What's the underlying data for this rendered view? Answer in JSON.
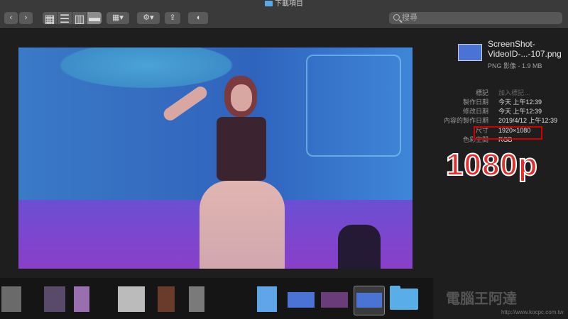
{
  "window": {
    "title": "下載項目"
  },
  "toolbar": {
    "back_label": "‹",
    "forward_label": "›",
    "views": [
      "▦",
      "☰",
      "▥",
      "▬"
    ],
    "group_label": "▦▾",
    "action_label": "⚙▾",
    "share_label": "⇪",
    "tag_label": "◖"
  },
  "search": {
    "placeholder": "搜尋"
  },
  "file": {
    "name": "ScreenShot-VideoID-...-107.png",
    "subtitle": "PNG 影像 - 1.9 MB"
  },
  "metadata": [
    {
      "key": "標記",
      "value": "加入標記…",
      "placeholder": true
    },
    {
      "key": "製作日期",
      "value": "今天 上午12:39"
    },
    {
      "key": "修改日期",
      "value": "今天 上午12:39"
    },
    {
      "key": "內容的製作日期",
      "value": "2019/4/12 上午12:39"
    },
    {
      "key": "尺寸",
      "value": "1920×1080"
    },
    {
      "key": "色彩空間",
      "value": "RGB"
    }
  ],
  "annotation": {
    "text": "1080p",
    "color": "#e42d2d"
  },
  "watermark": {
    "text": "電腦王阿達",
    "url": "http://www.kocpc.com.tw"
  },
  "colors": {
    "highlight": "#d40000",
    "folder": "#5aaee8"
  }
}
